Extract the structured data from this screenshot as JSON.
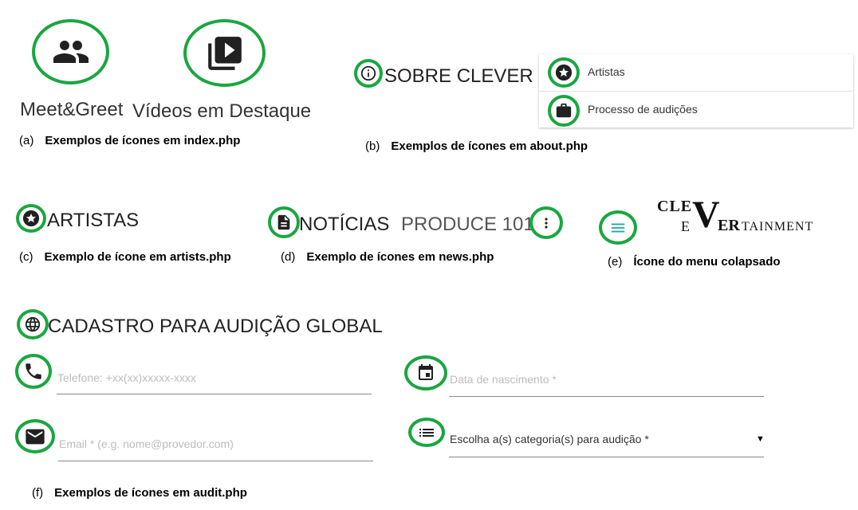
{
  "index": {
    "meet_label": "Meet&Greet",
    "videos_label": "Vídeos em Destaque",
    "caption_letter": "(a)",
    "caption_text": "Exemplos de ícones em index.php",
    "icons": [
      "people-icon",
      "video-library-icon"
    ]
  },
  "about": {
    "title": "SOBRE CLEVER",
    "menu_items": [
      {
        "label": "Artistas",
        "icon": "star-icon"
      },
      {
        "label": "Processo de audições",
        "icon": "briefcase-icon"
      }
    ],
    "caption_letter": "(b)",
    "caption_text": "Exemplos de ícones em about.php"
  },
  "artists": {
    "title": "ARTISTAS",
    "caption_letter": "(c)",
    "caption_text": "Exemplo de ícone em artists.php"
  },
  "news": {
    "title": "NOTÍCIAS",
    "subtitle": "PRODUCE 101",
    "caption_letter": "(d)",
    "caption_text": "Exemplo de ícones em news.php"
  },
  "menu": {
    "logo_line1": "CLE",
    "logo_line2a": "E",
    "logo_big": "V",
    "logo_line2b": "ER",
    "logo_line2c": "TAINMENT",
    "caption_letter": "(e)",
    "caption_text": "Ícone do menu colapsado"
  },
  "audit": {
    "title": "CADASTRO PARA AUDIÇÃO GLOBAL",
    "phone_placeholder": "Telefone: +xx(xx)xxxxx-xxxx",
    "birth_placeholder": "Data de nascimento *",
    "email_placeholder": "Email * (e.g. nome@provedor.com)",
    "category_value": "Escolha a(s) categoria(s) para audição *",
    "dropdown_arrow": "▼",
    "caption_letter": "(f)",
    "caption_text": "Exemplos de ícones em audit.php"
  },
  "colors": {
    "ring": "#1aa640",
    "menu_icon": "#26a69a",
    "icon": "#212121"
  }
}
